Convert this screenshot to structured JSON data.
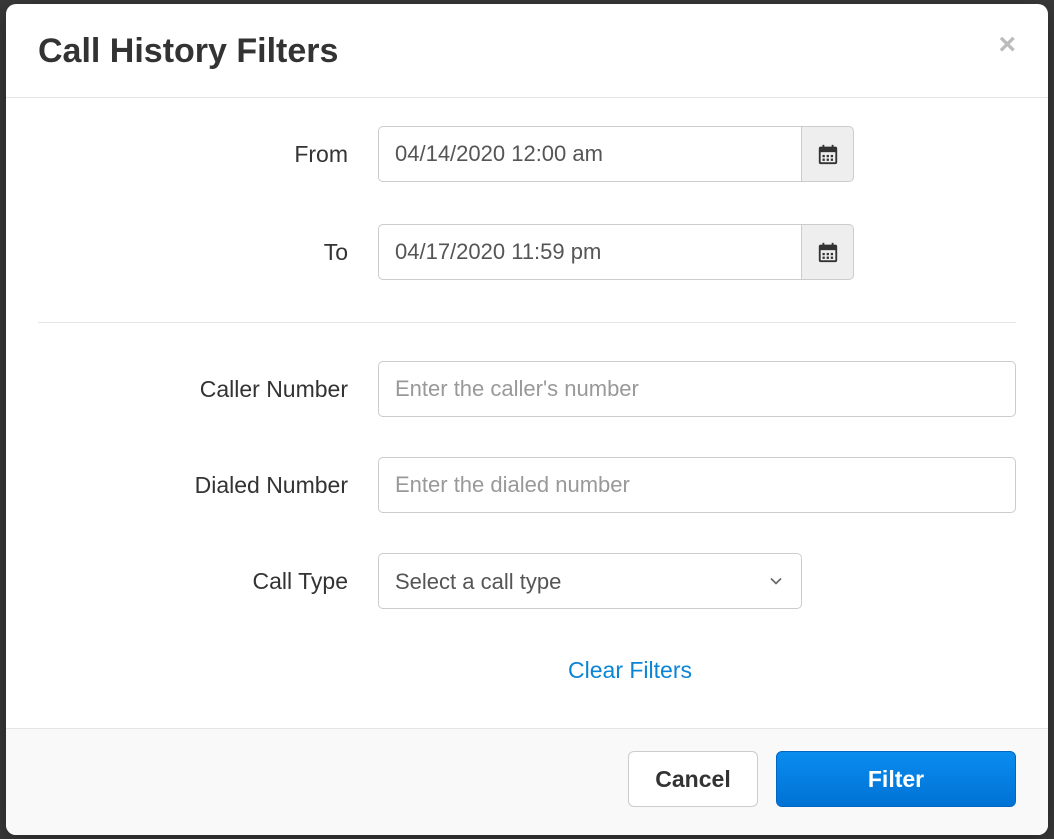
{
  "modal": {
    "title": "Call History Filters",
    "fields": {
      "from": {
        "label": "From",
        "value": "04/14/2020 12:00 am"
      },
      "to": {
        "label": "To",
        "value": "04/17/2020 11:59 pm"
      },
      "caller_number": {
        "label": "Caller Number",
        "placeholder": "Enter the caller's number",
        "value": ""
      },
      "dialed_number": {
        "label": "Dialed Number",
        "placeholder": "Enter the dialed number",
        "value": ""
      },
      "call_type": {
        "label": "Call Type",
        "placeholder": "Select a call type",
        "value": ""
      }
    },
    "clear_link": "Clear Filters",
    "buttons": {
      "cancel": "Cancel",
      "filter": "Filter"
    }
  }
}
